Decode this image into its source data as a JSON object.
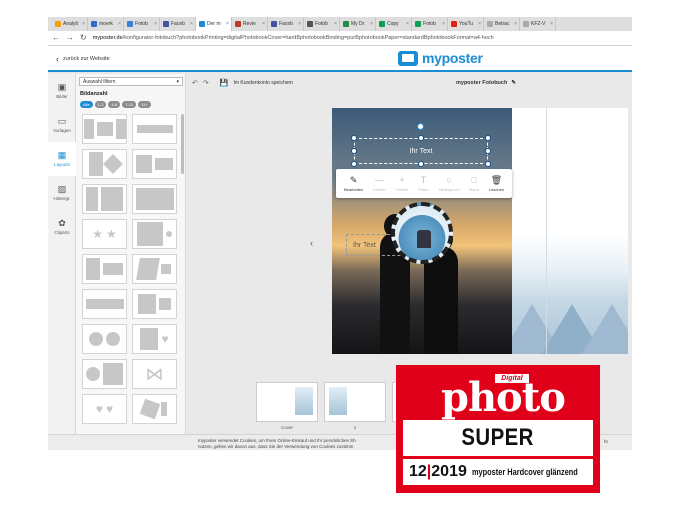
{
  "browser": {
    "tabs": [
      {
        "label": "Analyti",
        "color": "#f4a100"
      },
      {
        "label": "moerk",
        "color": "#2a6fcf"
      },
      {
        "label": "Fotob",
        "color": "#3b7dd8"
      },
      {
        "label": "Faceb",
        "color": "#3b5998"
      },
      {
        "label": "Der m",
        "color": "#1a8dd6",
        "active": true
      },
      {
        "label": "Revie",
        "color": "#c0392b"
      },
      {
        "label": "Faceb",
        "color": "#3b5998"
      },
      {
        "label": "Fotob",
        "color": "#555555"
      },
      {
        "label": "My Dr",
        "color": "#1e8e3e"
      },
      {
        "label": "Copy",
        "color": "#0f9d58"
      },
      {
        "label": "Fotob",
        "color": "#0f9d58"
      },
      {
        "label": "YouTu",
        "color": "#e62117"
      },
      {
        "label": "Betrac",
        "color": "#aaaaaa"
      },
      {
        "label": "KFZ-V",
        "color": "#aaaaaa"
      }
    ],
    "url_domain": "myposter.de",
    "url_path": "/konfigurator-fotobuch?photobookPrinting=digitalPhotobookCover=hardBphotobookBinding=purBphotobookPaper=standardBphotobookFormat=a4-hoch"
  },
  "header": {
    "back_label": "zurück zur Website",
    "logo_text": "myposter",
    "brand_color": "#1a8dd6"
  },
  "rail": {
    "items": [
      {
        "label": "Bilder",
        "icon": "images-icon"
      },
      {
        "label": "Vorlagen",
        "icon": "templates-icon"
      },
      {
        "label": "Layouts",
        "icon": "layouts-icon",
        "active": true
      },
      {
        "label": "Hintergr.",
        "icon": "background-icon"
      },
      {
        "label": "Cliparts",
        "icon": "clipart-icon"
      }
    ]
  },
  "panel": {
    "filter_value": "Auswahl filtern",
    "heading": "Bildanzahl",
    "chips": [
      "Alle",
      "1-3",
      "4-6",
      "7-10",
      "11+"
    ]
  },
  "editor": {
    "save_label": "Im Kundenkonto speichern",
    "book_title": "myposter Fotobuch",
    "textbox_text": "Ihr Text",
    "right_text": "Ihr Text",
    "page_label": "Seite 4 | 5",
    "popup": [
      {
        "label": "Bearbeiten",
        "glyph": "✎",
        "icon": "pencil-icon",
        "enabled": true
      },
      {
        "label": "Kleiner",
        "glyph": "—",
        "icon": "minus-icon",
        "enabled": false
      },
      {
        "label": "Größer",
        "glyph": "+",
        "icon": "plus-icon",
        "enabled": false
      },
      {
        "label": "Farbe",
        "glyph": "T",
        "icon": "text-color-icon",
        "enabled": false
      },
      {
        "label": "Hintergrund",
        "glyph": "○",
        "icon": "background-circle-icon",
        "enabled": false
      },
      {
        "label": "Rand",
        "glyph": "□",
        "icon": "border-icon",
        "enabled": false
      },
      {
        "label": "Löschen",
        "glyph": "🗑",
        "icon": "trash-icon",
        "enabled": true
      }
    ],
    "strip_labels": [
      "Cover",
      "1",
      "2"
    ]
  },
  "cookie": {
    "line1": "myposter verwendet Cookies, um Ihren Online-Einkauf und Ihr persönliches Sh",
    "line2": "nutzen, gehen wir davon aus, dass Sie der Verwendung von Cookies zustimm",
    "more": "hr"
  },
  "badge": {
    "digital": "Digital",
    "photo": "photo",
    "rating": "SUPER",
    "month": "12",
    "year": "2019",
    "product": "myposter Hardcover glänzend",
    "color": "#e1001a"
  }
}
